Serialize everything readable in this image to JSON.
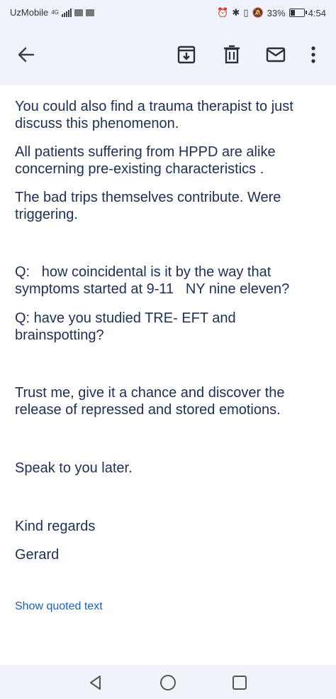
{
  "status_bar": {
    "carrier": "UzMobile",
    "network": "4G",
    "battery": "33%",
    "battery_fraction": 0.33,
    "time": "4:54"
  },
  "toolbar": {
    "icons": [
      "back-arrow-icon",
      "archive-icon",
      "trash-icon",
      "mail-icon",
      "more-vert-icon"
    ]
  },
  "email": {
    "paragraphs": [
      "You could also find a trauma therapist to just discuss this phenomenon.",
      "All patients suffering from HPPD are alike concerning pre-existing characteristics .",
      "The bad trips themselves contribute. Were triggering.",
      "Q:   how coincidental is it by the way that symptoms started at 9-11   NY nine eleven?",
      "Q: have you studied TRE- EFT and brainspotting?",
      "Trust me, give it a chance and discover the release of repressed and stored emotions.",
      "Speak to you later.",
      "Kind regards",
      "Gerard"
    ],
    "show_quoted_label": "Show quoted text"
  },
  "nav": {
    "icons": [
      "nav-back-icon",
      "nav-home-icon",
      "nav-recents-icon"
    ]
  },
  "colors": {
    "bar_bg": "#f0f4fa",
    "body_text": "#1d2f55",
    "link": "#1a5fc1"
  }
}
